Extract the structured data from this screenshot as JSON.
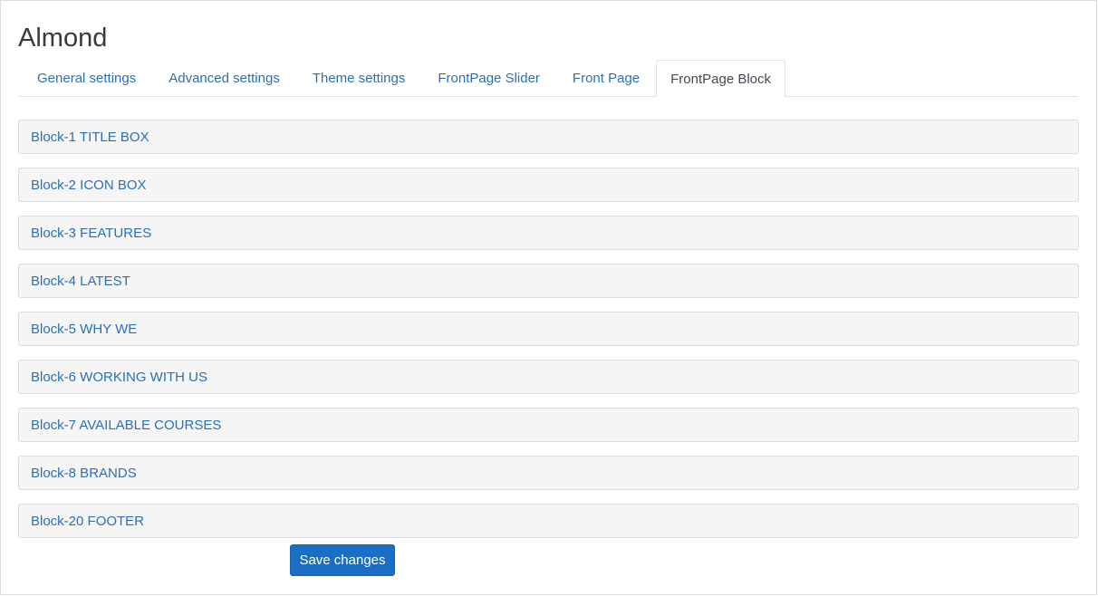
{
  "page": {
    "title": "Almond"
  },
  "tabs": [
    {
      "label": "General settings",
      "active": false
    },
    {
      "label": "Advanced settings",
      "active": false
    },
    {
      "label": "Theme settings",
      "active": false
    },
    {
      "label": "FrontPage Slider",
      "active": false
    },
    {
      "label": "Front Page",
      "active": false
    },
    {
      "label": "FrontPage Block",
      "active": true
    }
  ],
  "blocks": [
    {
      "label": "Block-1 TITLE BOX"
    },
    {
      "label": "Block-2 ICON BOX"
    },
    {
      "label": "Block-3 FEATURES"
    },
    {
      "label": "Block-4 LATEST"
    },
    {
      "label": "Block-5 WHY WE"
    },
    {
      "label": "Block-6 WORKING WITH US"
    },
    {
      "label": "Block-7 AVAILABLE COURSES"
    },
    {
      "label": "Block-8 BRANDS"
    },
    {
      "label": "Block-20 FOOTER"
    }
  ],
  "actions": {
    "save_label": "Save changes"
  },
  "colors": {
    "link": "#2f6fb0",
    "primary_button": "#1a6fc4",
    "block_bg": "#f5f5f5"
  }
}
